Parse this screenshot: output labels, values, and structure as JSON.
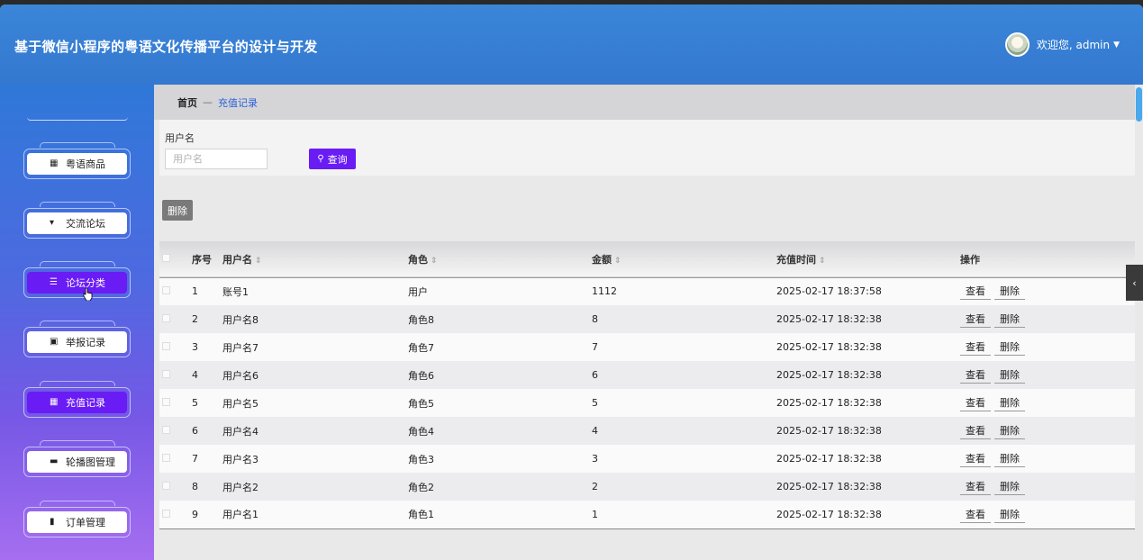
{
  "header": {
    "title": "基于微信小程序的粤语文化传播平台的设计与开发",
    "welcome": "欢迎您, admin",
    "caret_icon": "caret-down-icon"
  },
  "sidebar": {
    "items": [
      {
        "label": "粤语商品",
        "icon": "grid-icon",
        "active": false
      },
      {
        "label": "交流论坛",
        "icon": "comment-icon",
        "active": false
      },
      {
        "label": "论坛分类",
        "icon": "list-icon",
        "active": true
      },
      {
        "label": "举报记录",
        "icon": "clipboard-icon",
        "active": false
      },
      {
        "label": "充值记录",
        "icon": "grid-icon",
        "active": true
      },
      {
        "label": "轮播图管理",
        "icon": "message-icon",
        "active": false
      },
      {
        "label": "订单管理",
        "icon": "bar-chart-icon",
        "active": false
      }
    ]
  },
  "breadcrumb": {
    "home": "首页",
    "separator": "—",
    "current": "充值记录"
  },
  "search": {
    "label": "用户名",
    "placeholder": "用户名",
    "button": "查询"
  },
  "toolbar": {
    "delete_label": "删除"
  },
  "table": {
    "headers": {
      "index": "序号",
      "username": "用户名",
      "role": "角色",
      "amount": "金额",
      "time": "充值时间",
      "ops": "操作"
    },
    "view_label": "查看",
    "delete_label": "删除",
    "rows": [
      {
        "index": "1",
        "username": "账号1",
        "role": "用户",
        "amount": "1112",
        "time": "2025-02-17 18:37:58"
      },
      {
        "index": "2",
        "username": "用户名8",
        "role": "角色8",
        "amount": "8",
        "time": "2025-02-17 18:32:38"
      },
      {
        "index": "3",
        "username": "用户名7",
        "role": "角色7",
        "amount": "7",
        "time": "2025-02-17 18:32:38"
      },
      {
        "index": "4",
        "username": "用户名6",
        "role": "角色6",
        "amount": "6",
        "time": "2025-02-17 18:32:38"
      },
      {
        "index": "5",
        "username": "用户名5",
        "role": "角色5",
        "amount": "5",
        "time": "2025-02-17 18:32:38"
      },
      {
        "index": "6",
        "username": "用户名4",
        "role": "角色4",
        "amount": "4",
        "time": "2025-02-17 18:32:38"
      },
      {
        "index": "7",
        "username": "用户名3",
        "role": "角色3",
        "amount": "3",
        "time": "2025-02-17 18:32:38"
      },
      {
        "index": "8",
        "username": "用户名2",
        "role": "角色2",
        "amount": "2",
        "time": "2025-02-17 18:32:38"
      },
      {
        "index": "9",
        "username": "用户名1",
        "role": "角色1",
        "amount": "1",
        "time": "2025-02-17 18:32:38"
      }
    ]
  },
  "colors": {
    "header": "#3478cf",
    "accent": "#6a1cf5",
    "link": "#2b5fd9"
  }
}
